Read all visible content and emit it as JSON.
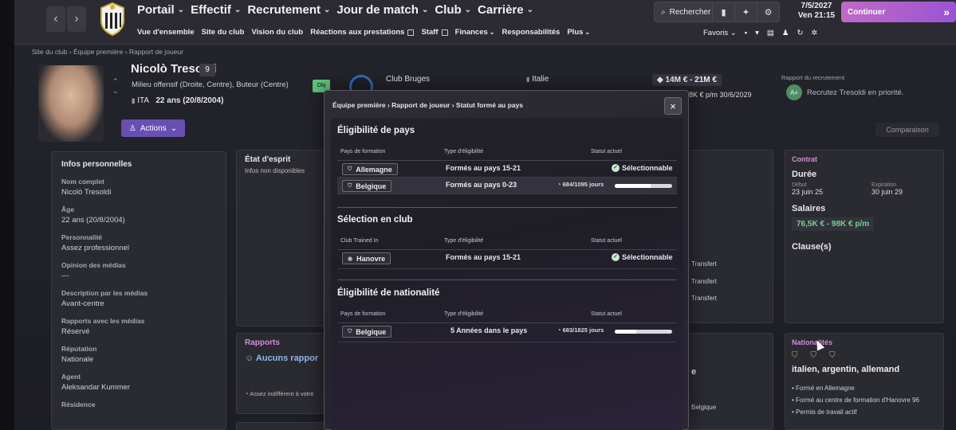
{
  "nav": {
    "back": "‹",
    "forward": "›",
    "main": [
      "Portail",
      "Effectif",
      "Recrutement",
      "Jour de match",
      "Club",
      "Carrière"
    ],
    "sub": [
      "Vue d'ensemble",
      "Site du club",
      "Vision du club",
      "Réactions aux prestations",
      "Staff",
      "Finances",
      "Responsabilités",
      "Plus"
    ],
    "search": "Rechercher",
    "date_line1": "7/5/2027",
    "date_line2": "Ven 21:15",
    "continue": "Continuer",
    "continue_icon": "»",
    "favoris": "Favoris"
  },
  "breadcrumb": "Site du club  ›  Équipe première  ›  Rapport de joueur",
  "player": {
    "name": "Nicolò Tresoldi",
    "number": "9",
    "position": "Milieu offensif (Droite, Centre), Buteur (Centre)",
    "nation": "ITA",
    "age_line": "22 ans (20/8/2004)",
    "actions": "Actions",
    "objective_badge": "Obj",
    "club": "Club Bruges",
    "nationality_top": "Italie",
    "value": "14M € - 21M €",
    "wage": "€ - 98K € p/m  30/6/2029",
    "scout_title": "Rapport du recrutement",
    "scout_grade": "A+",
    "scout_text": "Recrutez Tresoldi en priorité.",
    "comparison": "Comparaison"
  },
  "info": {
    "title": "Infos personnelles",
    "items": [
      {
        "label": "Nom complet",
        "value": "Nicolò Tresoldi"
      },
      {
        "label": "Âge",
        "value": "22 ans (20/8/2004)"
      },
      {
        "label": "Personnalité",
        "value": "Assez professionnel"
      },
      {
        "label": "Opinion des médias",
        "value": "---"
      },
      {
        "label": "Description par les médias",
        "value": "Avant-centre"
      },
      {
        "label": "Rapports avec les médias",
        "value": "Réservé"
      },
      {
        "label": "Réputation",
        "value": "Nationale"
      },
      {
        "label": "Agent",
        "value": "Aleksandar Kummer"
      },
      {
        "label": "Résidence",
        "value": ""
      }
    ]
  },
  "mood": {
    "title": "État d'esprit",
    "text": "Infos non disponibles"
  },
  "reports": {
    "title": "Rapports",
    "none": "Aucuns rappor",
    "note": "Assez indifférent à votre"
  },
  "contract": {
    "title": "Contrat",
    "duration": "Durée",
    "start_label": "Début",
    "start": "23 juin 25",
    "end_label": "Expiration",
    "end": "30 juin 29",
    "wages": "Salaires",
    "wage_value": "76,5K € - 98K € p/m",
    "clauses": "Clause(s)"
  },
  "transfers": [
    "Transfert",
    "Transfert",
    "Transfert"
  ],
  "fragment_e": "e",
  "fragment_belgique": "Belgique",
  "nationalities": {
    "title": "Nationalités",
    "list": "italien, argentin, allemand",
    "bullets": [
      "Formé en Allemagne",
      "Formé au centre de formation d'Hanovre 96",
      "Permis de travail actif"
    ]
  },
  "modal": {
    "breadcrumb": "Équipe première  ›  Rapport de joueur  ›  Statut formé au pays",
    "close": "×",
    "country": {
      "title": "Éligibilité de pays",
      "cols": [
        "Pays de formation",
        "Type d'éligibilité",
        "Statut actuel"
      ],
      "rows": [
        {
          "tag": "Allemagne",
          "type": "Formés au pays 15-21",
          "status": "Sélectionnable"
        },
        {
          "tag": "Belgique",
          "type": "Formés au pays 0-23",
          "days": "684/1095 jours",
          "progress": 0.62
        }
      ]
    },
    "club": {
      "title": "Sélection en club",
      "cols": [
        "Club Trained In",
        "Type d'éligibilité",
        "Statut actuel"
      ],
      "rows": [
        {
          "tag": "Hanovre",
          "type": "Formés au pays 15-21",
          "status": "Sélectionnable"
        }
      ]
    },
    "nationality": {
      "title": "Éligibilité de nationalité",
      "cols": [
        "Pays de formation",
        "Type d'éligibilité",
        "Statut actuel"
      ],
      "rows": [
        {
          "tag": "Belgique",
          "type": "5 Années dans le pays",
          "days": "683/1825 jours",
          "progress": 0.37
        }
      ]
    }
  }
}
